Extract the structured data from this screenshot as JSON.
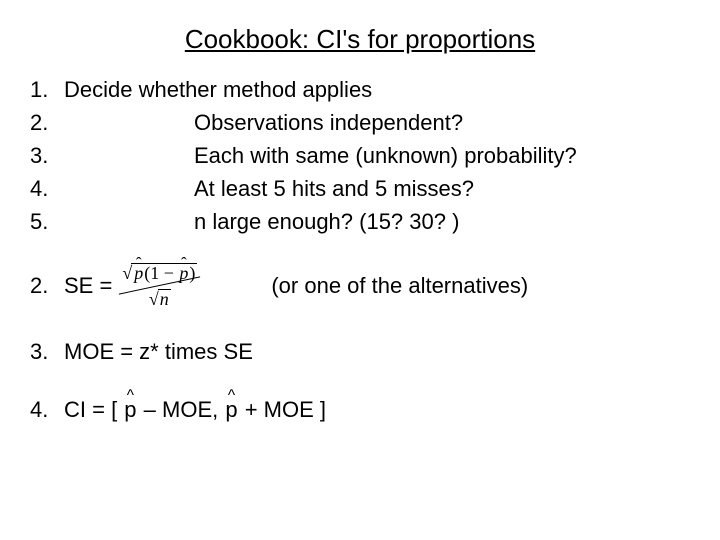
{
  "title": "Cookbook:  CI's for proportions",
  "list1": {
    "n1": "1.",
    "n2": "2.",
    "n3": "3.",
    "n4": "4.",
    "n5": "5.",
    "t1": "Decide whether method applies",
    "t2": "Observations independent?",
    "t3": "Each with same (unknown) probability?",
    "t4": "At least 5 hits and 5 misses?",
    "t5": "n large enough?  (15?  30? )"
  },
  "step2": {
    "num": "2.",
    "label": "SE =",
    "alt": "(or one of the alternatives)",
    "formula": {
      "phat": "p",
      "one_minus": "(1 − ",
      "close": ")",
      "n": "n"
    }
  },
  "step3": {
    "num": "3.",
    "text": "MOE = z* times SE"
  },
  "step4": {
    "num": "4.",
    "pre": "CI = [ ",
    "mid": " – MOE,  ",
    "post": " + MOE ]",
    "phat": "p"
  }
}
